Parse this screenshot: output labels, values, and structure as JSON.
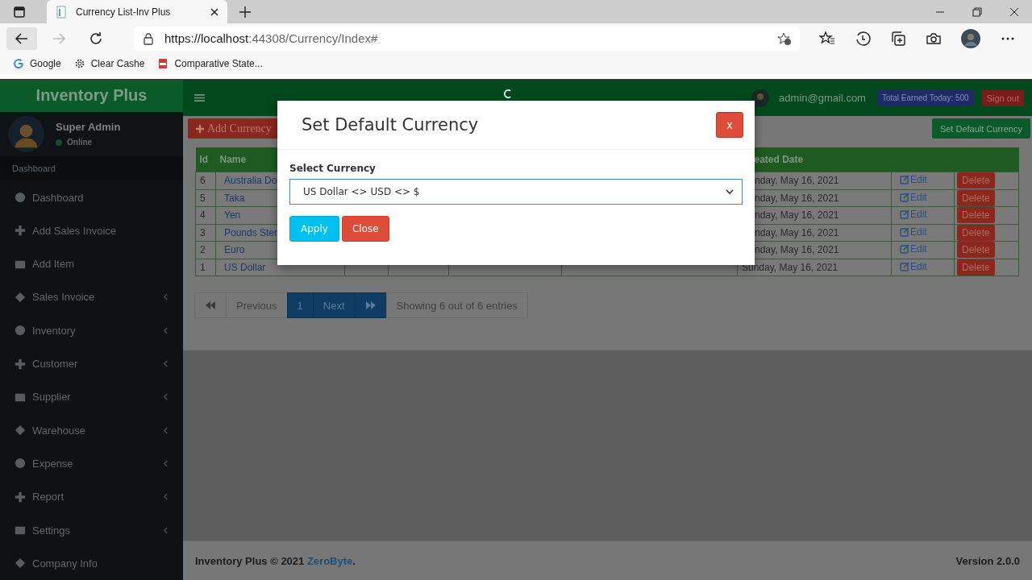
{
  "browser": {
    "tab_title": "Currency List-Inv Plus",
    "url_host": "https://localhost",
    "url_rest": ":44308/Currency/Index#",
    "bookmarks": [
      "Google",
      "Clear Cashe",
      "Comparative State..."
    ]
  },
  "app": {
    "brand": "Inventory Plus",
    "user": {
      "name": "Super Admin",
      "status": "Online"
    },
    "sidebar_header": "Dashboard",
    "sidebar": {
      "items": [
        {
          "label": "Dashboard",
          "has_submenu": false
        },
        {
          "label": "Add Sales Invoice",
          "has_submenu": false
        },
        {
          "label": "Add Item",
          "has_submenu": false
        },
        {
          "label": "Sales Invoice",
          "has_submenu": true
        },
        {
          "label": "Inventory",
          "has_submenu": true
        },
        {
          "label": "Customer",
          "has_submenu": true
        },
        {
          "label": "Supplier",
          "has_submenu": true
        },
        {
          "label": "Warehouse",
          "has_submenu": true
        },
        {
          "label": "Expense",
          "has_submenu": true
        },
        {
          "label": "Report",
          "has_submenu": true
        },
        {
          "label": "Settings",
          "has_submenu": true
        },
        {
          "label": "Company Info",
          "has_submenu": false
        }
      ]
    }
  },
  "topbar": {
    "email": "admin@gmail.com",
    "earned": "Total Earned Today: 500",
    "sign_out": "Sign out"
  },
  "toolbar": {
    "add_button": "Add Currency",
    "default_button": "Set Default Currency"
  },
  "table": {
    "columns": [
      "Id",
      "Name",
      "eated Date"
    ],
    "rows": [
      {
        "id": "6",
        "name": "Australia Do",
        "date": "nday, May 16, 2021",
        "edit": "Edit",
        "delete": "Delete"
      },
      {
        "id": "5",
        "name": "Taka",
        "date": "nday, May 16, 2021",
        "edit": "Edit",
        "delete": "Delete"
      },
      {
        "id": "4",
        "name": "Yen",
        "date": "nday, May 16, 2021",
        "edit": "Edit",
        "delete": "Delete"
      },
      {
        "id": "3",
        "name": "Pounds Ster",
        "date": "nday, May 16, 2021",
        "edit": "Edit",
        "delete": "Delete"
      },
      {
        "id": "2",
        "name": "Euro",
        "date": "nday, May 16, 2021",
        "edit": "Edit",
        "delete": "Delete"
      },
      {
        "id": "1",
        "name": "US Dollar",
        "date": "Sunday, May 16, 2021",
        "full_date": true,
        "edit": "Edit",
        "delete": "Delete"
      }
    ]
  },
  "pagination": {
    "previous": "Previous",
    "pages": [
      {
        "label": "1",
        "selected": true
      }
    ],
    "next": "Next",
    "info": "Showing 6 out of 6 entries"
  },
  "modal": {
    "title": "Set Default Currency",
    "close_x": "x",
    "field_label": "Select Currency",
    "value": "US Dollar <> USD <> $",
    "apply": "Apply",
    "close": "Close"
  },
  "footer": {
    "text": "Inventory Plus © 2021",
    "link": "ZeroByte",
    "end": ".",
    "version": "Version 2.0.0"
  }
}
